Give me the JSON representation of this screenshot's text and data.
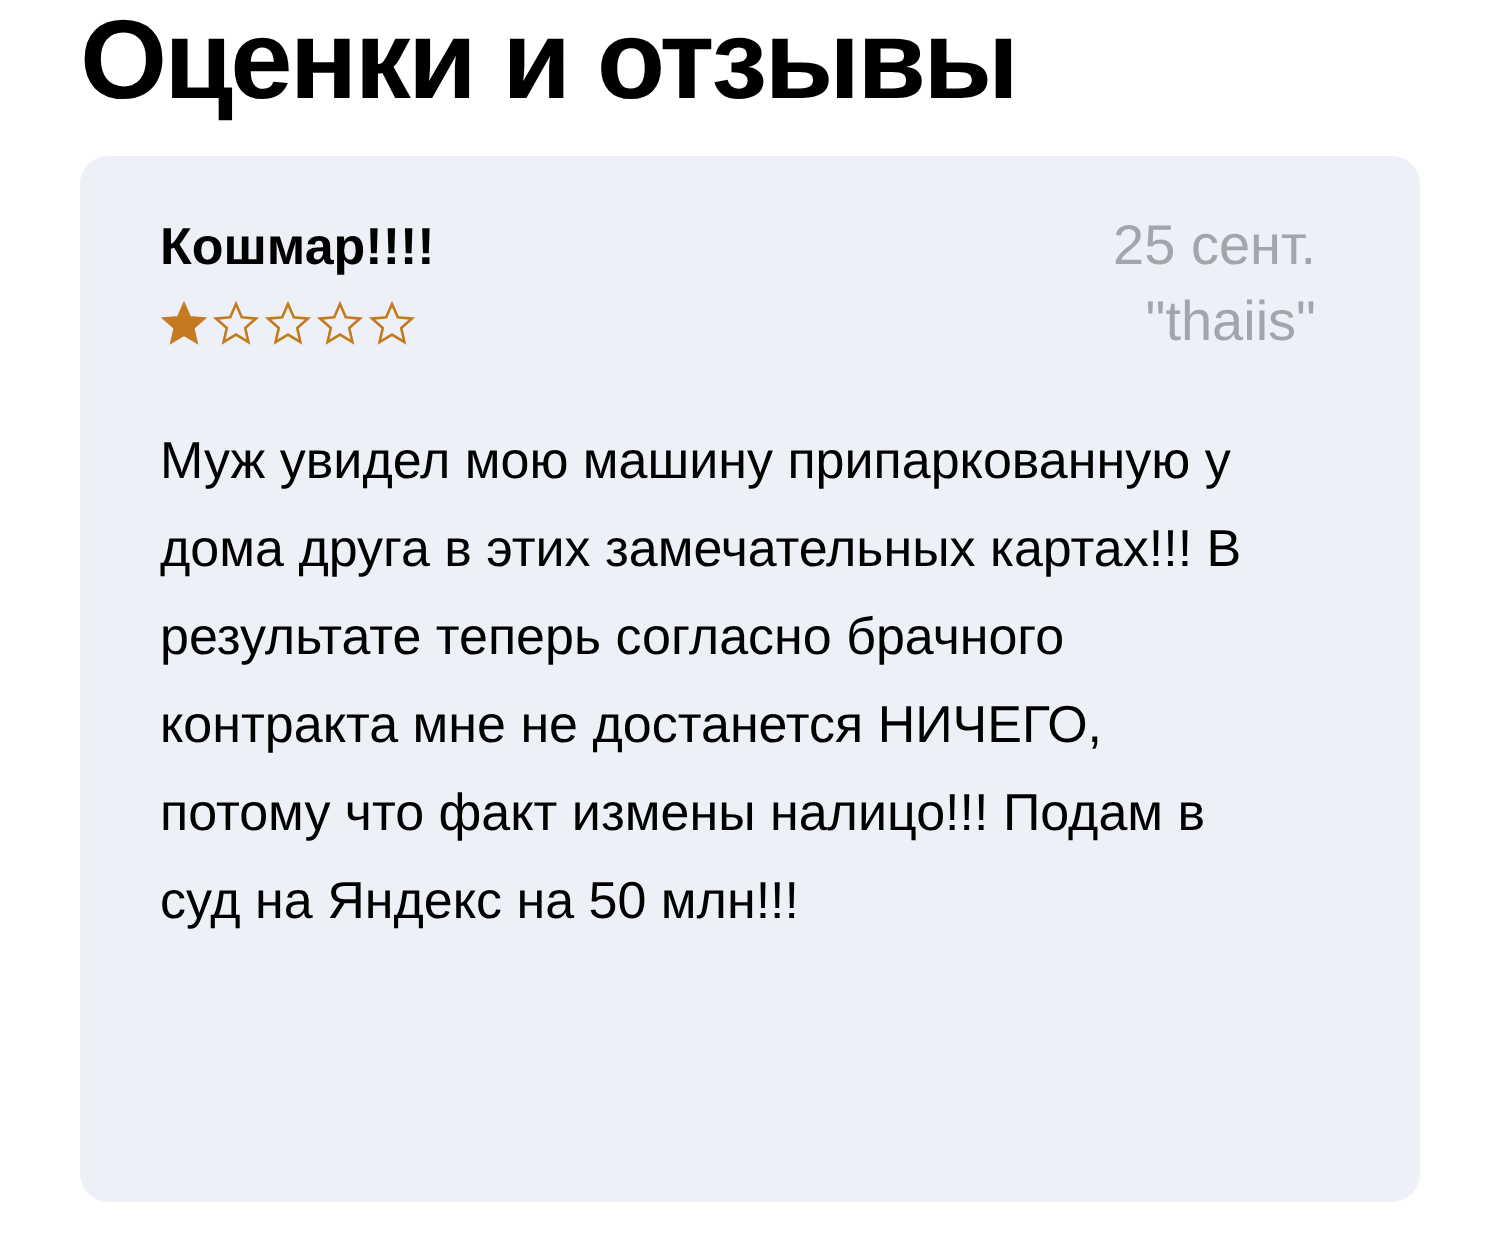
{
  "heading": "Оценки и отзывы",
  "review": {
    "title": "Кошмар!!!!",
    "stars": 1,
    "date": "25 сент.",
    "author": "\"thaiis\"",
    "body": "Муж увидел мою машину припаркованную у дома друга в этих замечательных картах!!! В результате теперь согласно брачного контракта мне не достанется НИЧЕГО, потому что факт измены налицо!!! Подам в суд на Яндекс на 50 млн!!!"
  }
}
